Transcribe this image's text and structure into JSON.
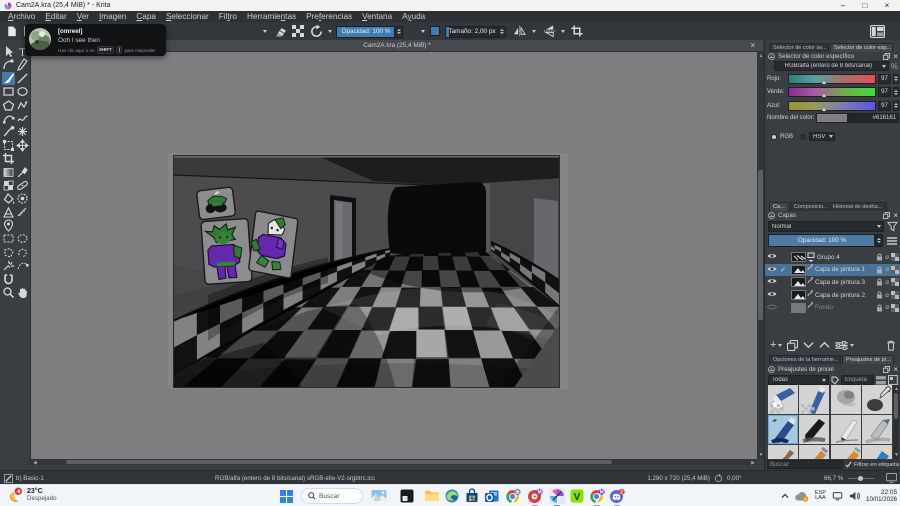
{
  "window": {
    "title": "Cam2A.kra (25,4 MiB) * - Krita",
    "minimize": "–",
    "maximize": "□",
    "close": "×"
  },
  "menu": {
    "items": [
      {
        "label": "Archivo",
        "u": 0
      },
      {
        "label": "Editar",
        "u": 0
      },
      {
        "label": "Ver",
        "u": 0
      },
      {
        "label": "Imagen",
        "u": 0
      },
      {
        "label": "Capa",
        "u": 0
      },
      {
        "label": "Seleccionar",
        "u": 0
      },
      {
        "label": "Filtro",
        "u": 3
      },
      {
        "label": "Herramientas",
        "u": 8
      },
      {
        "label": "Preferencias",
        "u": 3
      },
      {
        "label": "Ventana",
        "u": 0
      },
      {
        "label": "Ayuda",
        "u": 1
      }
    ]
  },
  "toolbar": {
    "opacity_label": "Opacidad: 100 %",
    "size_label": "Tamaño: 2,00 px",
    "accent_blue": "#3e7cb1"
  },
  "subwindow": {
    "title": "Cam2A.kra (25,4 MiB) *",
    "close": "×"
  },
  "notification": {
    "username": "[omreel]",
    "message": "Ooh I see then",
    "hint_prefix": "Haz clic aquí o en",
    "key_shift": "SHIFT",
    "key_sep": "|",
    "hint_suffix": "para responder"
  },
  "toolbox": {
    "selected_tool": "freehand-brush",
    "tools": [
      "select-shapes",
      "text",
      "edit-shapes",
      "calligraphy",
      "freehand-brush",
      "line",
      "rectangle",
      "ellipse",
      "polygon",
      "polyline",
      "bezier-curve",
      "freehand-path",
      "dynamic-brush",
      "multibrush",
      "transform",
      "move",
      "crop",
      "blank",
      "gradient",
      "color-sampler",
      "pattern-edit",
      "smart-patch",
      "fill",
      "enclose-fill",
      "assistants",
      "measure",
      "reference-images",
      "blank2",
      "select-rect",
      "select-ellipse",
      "select-polygon",
      "select-freehand",
      "select-similar",
      "select-bezier",
      "select-magnetic",
      "blank3",
      "zoom",
      "pan"
    ]
  },
  "color_docker": {
    "tab_advanced": "Selector de color av...",
    "tab_specific": "Selector de color esp...",
    "title": "Selector de color específico",
    "model": "RGB/alfa (entero de 8 bits/canal)",
    "percent": "%",
    "channels": [
      {
        "label": "Rojo:",
        "value": "97",
        "grad": "linear-gradient(90deg,#2f7d7d,#57a0a0 30%,#b06a6a 65%,#e05252)"
      },
      {
        "label": "Verde:",
        "value": "97",
        "grad": "linear-gradient(90deg,#8d2b8d,#a85aa8 30%,#6fae4e 65%,#3ddd3d)"
      },
      {
        "label": "Azul:",
        "value": "97",
        "grad": "linear-gradient(90deg,#96962c,#9a9a5e 30%,#7a7ab4 65%,#5757e8)"
      }
    ],
    "marker_pos": 0.38,
    "color_name_label": "Nombre del color:",
    "color_hex": "#616161",
    "swatch_color": "#7f7f81",
    "rgb_label": "RGB",
    "hsv_label": "HSV"
  },
  "layers_docker": {
    "tabs": [
      "Ca...",
      "Composicio...",
      "Historial de desha..."
    ],
    "title": "Capas",
    "blend_mode": "Normal",
    "opacity_label": "Opacidad:  100 %",
    "selected_color": "#4a7297",
    "layers": [
      {
        "name": "Grupo 4",
        "kind": "group",
        "checked": false,
        "hidden": false
      },
      {
        "name": "Capa de pintura 1",
        "kind": "paint",
        "checked": true,
        "hidden": false,
        "selected": true
      },
      {
        "name": "Capa de pintura 3",
        "kind": "paint",
        "checked": false,
        "hidden": false
      },
      {
        "name": "Capa de pintura 2",
        "kind": "paint",
        "checked": false,
        "hidden": false
      },
      {
        "name": "Fondo",
        "kind": "paint",
        "checked": false,
        "hidden": true
      }
    ]
  },
  "presets_docker": {
    "tab_tool_options": "Opciones de la herramie...",
    "tab_presets": "Preajustes de pi...",
    "title": "Preajustes de pincel",
    "filter_all": "Todas",
    "tag_label": "Etiqueta",
    "search_placeholder": "Buscar",
    "filter_checkbox": "Filtrar en etiqueta",
    "selected_index": 4
  },
  "statusbar": {
    "brush": "b) Basic-1",
    "profile": "RGB/alfa (entero de 8 bits/canal)  sRGB-elle-V2-srgbtrc.icc",
    "dims": "1.280 x 720 (25,4 MiB)",
    "angle": "0,00°",
    "zoom": "66,7 %"
  },
  "taskbar": {
    "weather_temp": "23°C",
    "weather_desc": "Despejado",
    "weather_badge": "4",
    "search": "Buscar",
    "lang1": "ESP",
    "lang2": "LAA",
    "time": "22:05",
    "date": "10/01/2026",
    "icons": [
      "widgets",
      "photos-dark",
      "explorer",
      "edge",
      "store",
      "outlook",
      "chrome-badge1",
      "music-red",
      "krita-active",
      "v-green",
      "chrome-badge2",
      "discord-blue"
    ]
  }
}
